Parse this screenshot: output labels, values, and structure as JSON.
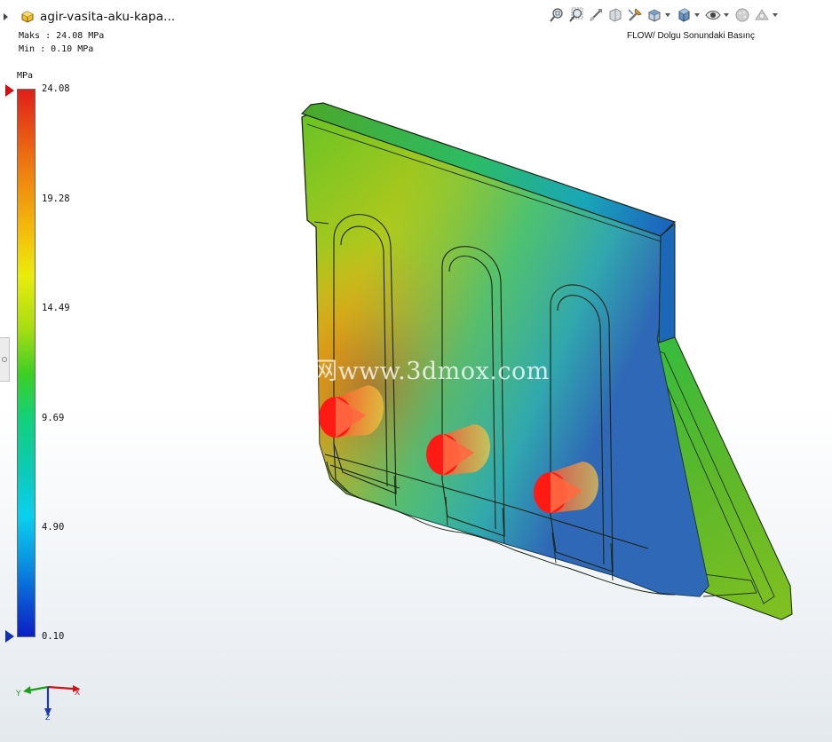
{
  "document": {
    "title": "agir-vasita-aku-kapa..."
  },
  "result": {
    "max_line": "Maks : 24.08 MPa",
    "min_line": "Min : 0.10 MPa",
    "title": "FLOW/ Dolgu Sonundaki Basınç"
  },
  "legend": {
    "unit": "MPa",
    "ticks": [
      "24.08",
      "19.28",
      "14.49",
      "9.69",
      "4.90",
      "0.10"
    ]
  },
  "toolbar": {
    "icons": [
      "zoom-to-fit-icon",
      "zoom-to-area-icon",
      "previous-view-icon",
      "section-view-icon",
      "dynamic-annotation-icon",
      "view-orientation-icon",
      "display-style-icon",
      "hide-show-items-icon",
      "edit-appearance-icon",
      "apply-scene-icon"
    ]
  },
  "triad": {
    "x": "X",
    "y": "Y",
    "z": "Z"
  },
  "watermark": "莫西网www.3dmox.com",
  "colors": {
    "max": "#e0201a",
    "min": "#0c1ec4",
    "injection": "#ff1a14"
  }
}
